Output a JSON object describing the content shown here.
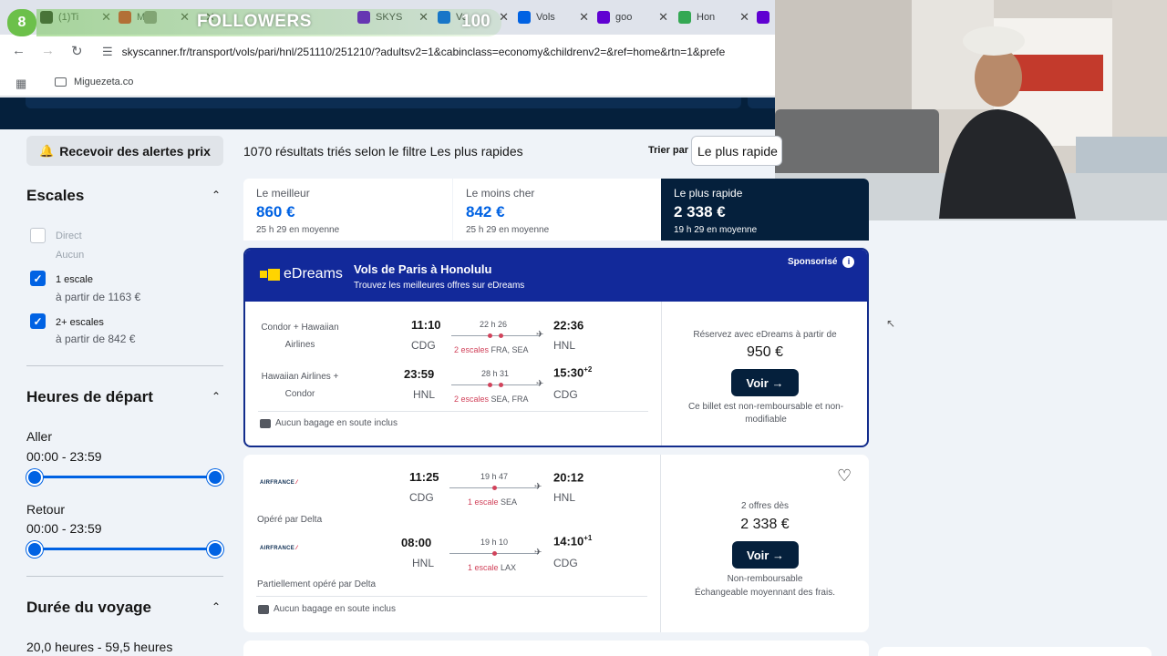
{
  "overlay": {
    "count": "8",
    "label": "FOLLOWERS",
    "goal": "100"
  },
  "browser": {
    "tabs": [
      {
        "label": "(1)Ti",
        "color": "#111111"
      },
      {
        "label": "M",
        "color": "#e62117"
      },
      {
        "label": "",
        "color": "#888888"
      },
      {
        "label": "SKYS",
        "color": "#6001d2"
      },
      {
        "label": "Vo",
        "color": "#0062e3"
      },
      {
        "label": "Vols",
        "color": "#0062e3"
      },
      {
        "label": "goo",
        "color": "#6001d2"
      },
      {
        "label": "Hon",
        "color": "#34a853"
      },
      {
        "label": "",
        "color": "#6001d2"
      }
    ],
    "url": "skyscanner.fr/transport/vols/pari/hnl/251110/251210/?adultsv2=1&cabinclass=economy&childrenv2=&ref=home&rtn=1&prefe",
    "bookmark": "Miguezeta.co"
  },
  "alert_button": "Recevoir des alertes prix",
  "results_text": "1070 résultats triés selon le filtre Les plus rapides",
  "sort": {
    "label": "Trier par",
    "value": "Le plus rapide"
  },
  "filters": {
    "stops": {
      "title": "Escales",
      "options": [
        {
          "label": "Direct",
          "sub": "Aucun",
          "checked": false
        },
        {
          "label": "1 escale",
          "sub": "à partir de 1163 €",
          "checked": true
        },
        {
          "label": "2+ escales",
          "sub": "à partir de 842 €",
          "checked": true
        }
      ]
    },
    "times": {
      "title": "Heures de départ",
      "outbound_label": "Aller",
      "outbound_range": "00:00 - 23:59",
      "return_label": "Retour",
      "return_range": "00:00 - 23:59"
    },
    "duration": {
      "title": "Durée du voyage",
      "range": "20,0 heures - 59,5 heures"
    }
  },
  "summary": [
    {
      "title": "Le meilleur",
      "price": "860 €",
      "duration": "25 h 29 en moyenne"
    },
    {
      "title": "Le moins cher",
      "price": "842 €",
      "duration": "25 h 29 en moyenne"
    },
    {
      "title": "Le plus rapide",
      "price": "2 338 €",
      "duration": "19 h 29 en moyenne"
    }
  ],
  "sponsored": {
    "brand": "eDreams",
    "title": "Vols de Paris à Honolulu",
    "subtitle": "Trouvez les meilleures offres sur eDreams",
    "badge": "Sponsorisé",
    "legs": [
      {
        "airline": "Condor + Hawaiian Airlines",
        "dep_time": "11:10",
        "dep": "CDG",
        "duration": "22 h 26",
        "stops": "2 escales",
        "via": "FRA, SEA",
        "arr_time": "22:36",
        "arr_plus": "",
        "arr": "HNL"
      },
      {
        "airline": "Hawaiian Airlines + Condor",
        "dep_time": "23:59",
        "dep": "HNL",
        "duration": "28 h 31",
        "stops": "2 escales",
        "via": "SEA, FRA",
        "arr_time": "15:30",
        "arr_plus": "+2",
        "arr": "CDG"
      }
    ],
    "baggage": "Aucun bagage en soute inclus",
    "price_caption": "Réservez avec eDreams à partir de",
    "price": "950 €",
    "button": "Voir →",
    "note": "Ce billet est non-remboursable et non-modifiable"
  },
  "result1": {
    "airline": "AIRFRANCE",
    "legs": [
      {
        "dep_time": "11:25",
        "dep": "CDG",
        "duration": "19 h 47",
        "stops": "1 escale",
        "via": "SEA",
        "arr_time": "20:12",
        "arr_plus": "",
        "arr": "HNL",
        "operated": "Opéré par Delta"
      },
      {
        "dep_time": "08:00",
        "dep": "HNL",
        "duration": "19 h 10",
        "stops": "1 escale",
        "via": "LAX",
        "arr_time": "14:10",
        "arr_plus": "+1",
        "arr": "CDG",
        "operated": "Partiellement opéré par Delta"
      }
    ],
    "baggage": "Aucun bagage en soute inclus",
    "offers": "2 offres dès",
    "price": "2 338 €",
    "button": "Voir →",
    "note1": "Non-remboursable",
    "note2": "Échangeable moyennant des frais."
  }
}
